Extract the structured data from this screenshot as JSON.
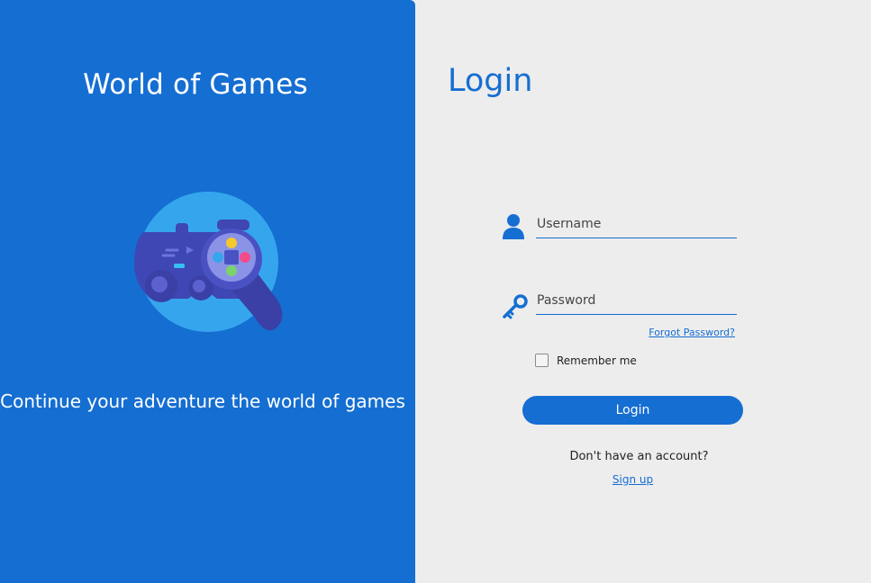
{
  "left_panel": {
    "app_title": "World of Games",
    "tagline": "Continue your adventure the world of games",
    "hero_icon": "gamepad-icon",
    "background_color": "#156ed2"
  },
  "login_form": {
    "title": "Login",
    "username": {
      "placeholder": "Username",
      "value": "",
      "icon": "user-icon"
    },
    "password": {
      "placeholder": "Password",
      "value": "",
      "icon": "key-icon"
    },
    "forgot_password": "Forgot Password?",
    "remember_me": {
      "label": "Remember me",
      "checked": false
    },
    "login_button": "Login",
    "no_account_text": "Don't have an account?",
    "signup_link": "Sign up"
  },
  "colors": {
    "accent": "#156ed2",
    "background": "#ededed"
  }
}
